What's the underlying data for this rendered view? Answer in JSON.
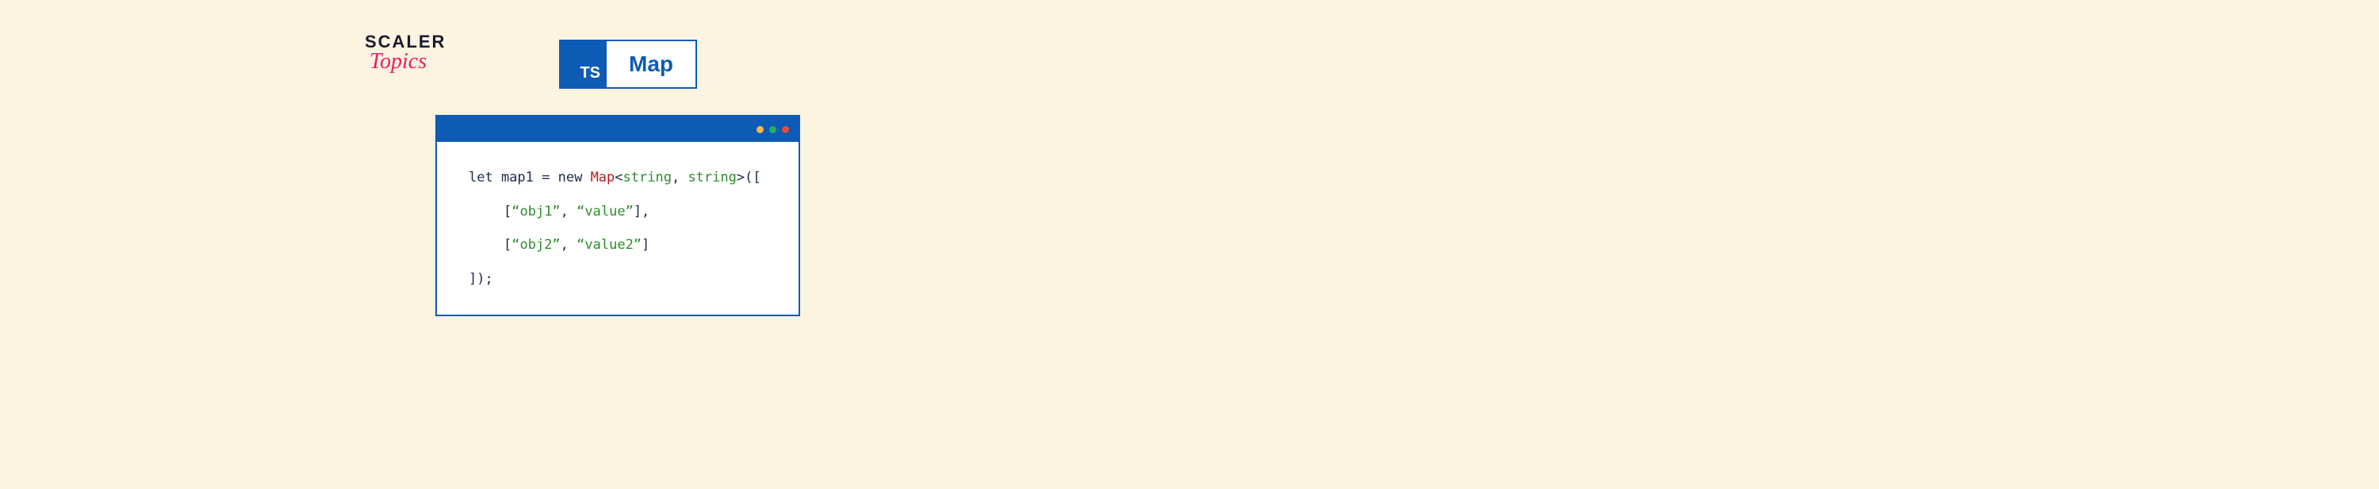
{
  "logo": {
    "line1": "SCALER",
    "line2": "Topics"
  },
  "title": {
    "badge": "TS",
    "text": "Map"
  },
  "code": {
    "line1": {
      "let": "let ",
      "varname": "map1 = ",
      "new": "new ",
      "classname": "Map",
      "lt": "<",
      "type1": "string",
      "comma": ", ",
      "type2": "string",
      "gt": ">",
      "open": "(["
    },
    "line2": {
      "bracket_open": "[",
      "str1": "“obj1”",
      "comma": ", ",
      "str2": "“value”",
      "bracket_close": "],"
    },
    "line3": {
      "bracket_open": "[",
      "str1": "“obj2”",
      "comma": ", ",
      "str2": "“value2”",
      "bracket_close": "]"
    },
    "line4": "]);"
  }
}
